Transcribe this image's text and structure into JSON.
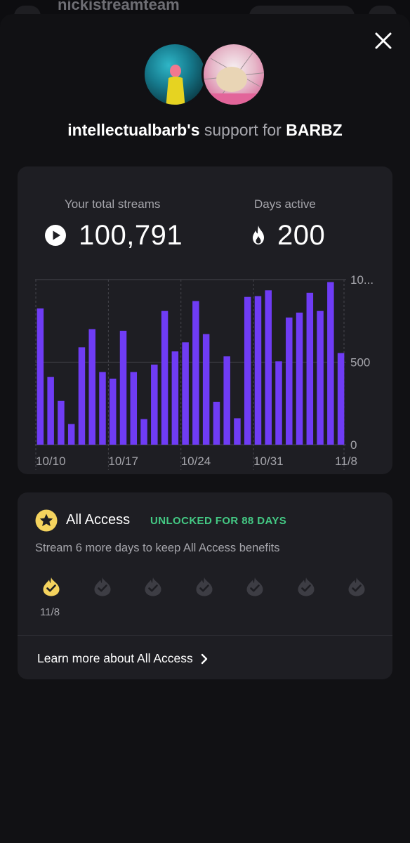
{
  "behind_title": "nickistreamteam",
  "close_icon": "close-icon",
  "header": {
    "username": "intellectualbarb's",
    "middle": "support for",
    "artist": "BARBZ"
  },
  "stats": {
    "streams_label": "Your total streams",
    "streams_value": "100,791",
    "streams_icon": "play-circle-icon",
    "days_label": "Days active",
    "days_value": "200",
    "days_icon": "flame-icon"
  },
  "chart_data": {
    "type": "bar",
    "y_ticks": [
      "10...",
      "500",
      "0"
    ],
    "ylim": [
      0,
      1000
    ],
    "x_ticks": [
      "10/10",
      "10/17",
      "10/24",
      "10/31",
      "11/8"
    ],
    "bar_color": "#6f3cf5",
    "grid": true,
    "categories": [
      "10/10",
      "10/11",
      "10/12",
      "10/13",
      "10/14",
      "10/15",
      "10/16",
      "10/17",
      "10/18",
      "10/19",
      "10/20",
      "10/21",
      "10/22",
      "10/23",
      "10/24",
      "10/25",
      "10/26",
      "10/27",
      "10/28",
      "10/29",
      "10/30",
      "10/31",
      "11/1",
      "11/2",
      "11/3",
      "11/4",
      "11/5",
      "11/6",
      "11/7",
      "11/8"
    ],
    "values": [
      825,
      410,
      265,
      125,
      590,
      700,
      440,
      400,
      690,
      440,
      155,
      485,
      810,
      565,
      620,
      870,
      670,
      260,
      535,
      160,
      895,
      900,
      935,
      505,
      770,
      800,
      920,
      810,
      985,
      555
    ]
  },
  "access": {
    "icon": "star-icon",
    "title": "All Access",
    "badge": "UNLOCKED FOR 88 DAYS",
    "subtitle": "Stream 6 more days to keep All Access benefits",
    "days": [
      {
        "label": "11/8",
        "done": true
      },
      {
        "label": "",
        "done": false
      },
      {
        "label": "",
        "done": false
      },
      {
        "label": "",
        "done": false
      },
      {
        "label": "",
        "done": false
      },
      {
        "label": "",
        "done": false
      },
      {
        "label": "",
        "done": false
      }
    ],
    "learn_more": "Learn more about All Access",
    "learn_icon": "chevron-right-icon",
    "active_color": "#f4d35e",
    "inactive_color": "#3d3d44"
  }
}
